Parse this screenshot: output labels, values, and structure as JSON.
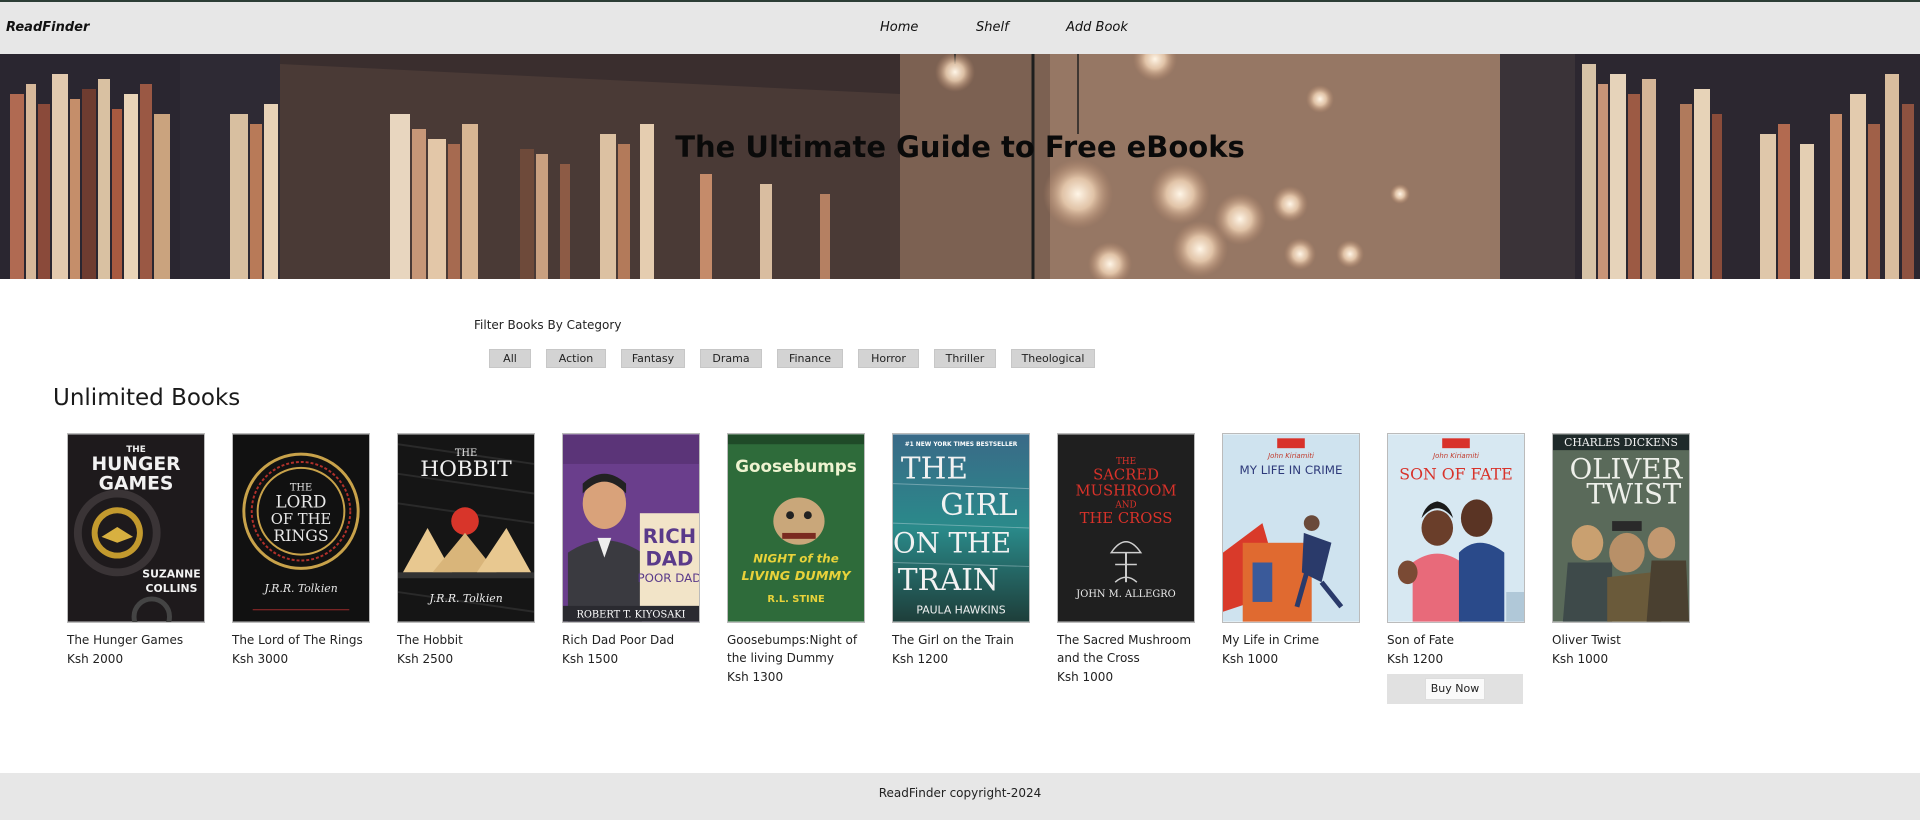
{
  "nav": {
    "brand": "ReadFinder",
    "links": [
      "Home",
      "Shelf",
      "Add Book"
    ]
  },
  "hero": {
    "title": "The Ultimate Guide to Free eBooks"
  },
  "filter": {
    "label": "Filter Books By Category",
    "categories": [
      "All",
      "Action",
      "Fantasy",
      "Drama",
      "Finance",
      "Horror",
      "Thriller",
      "Theological"
    ]
  },
  "books_section": {
    "title": "Unlimited Books",
    "buy_label": "Buy Now",
    "books": [
      {
        "title": "The Hunger Games",
        "price": "Ksh 2000",
        "cover_lines": [
          "THE",
          "HUNGER",
          "GAMES",
          "SUZANNE",
          "COLLINS"
        ]
      },
      {
        "title": "The Lord of The Rings",
        "price": "Ksh 3000",
        "cover_lines": [
          "THE",
          "LORD",
          "OF THE",
          "RINGS",
          "J.R.R. Tolkien"
        ]
      },
      {
        "title": "The Hobbit",
        "price": "Ksh 2500",
        "cover_lines": [
          "THE",
          "HOBBIT",
          "J.R.R. Tolkien"
        ]
      },
      {
        "title": "Rich Dad Poor Dad",
        "price": "Ksh 1500",
        "cover_lines": [
          "RICH",
          "DAD",
          "POOR DAD",
          "ROBERT T. KIYOSAKI"
        ]
      },
      {
        "title": "Goosebumps:Night of the living Dummy",
        "price": "Ksh 1300",
        "cover_lines": [
          "Goosebumps",
          "NIGHT of the",
          "LIVING DUMMY",
          "R.L. STINE"
        ]
      },
      {
        "title": "The Girl on the Train",
        "price": "Ksh 1200",
        "cover_lines": [
          "#1 NEW YORK TIMES BESTSELLER",
          "THE",
          "GIRL",
          "ON THE",
          "TRAIN",
          "PAULA HAWKINS"
        ]
      },
      {
        "title": "The Sacred Mushroom and the Cross",
        "price": "Ksh 1000",
        "cover_lines": [
          "THE",
          "SACRED",
          "MUSHROOM",
          "AND",
          "THE CROSS",
          "JOHN M. ALLEGRO"
        ]
      },
      {
        "title": "My Life in Crime",
        "price": "Ksh 1000",
        "cover_lines": [
          "John Kiriamiti",
          "MY LIFE IN CRIME"
        ]
      },
      {
        "title": "Son of Fate",
        "price": "Ksh 1200",
        "cover_lines": [
          "John Kiriamiti",
          "SON OF FATE"
        ]
      },
      {
        "title": "Oliver Twist",
        "price": "Ksh 1000",
        "cover_lines": [
          "CHARLES DICKENS",
          "OLIVER",
          "TWIST"
        ]
      }
    ]
  },
  "footer": {
    "text": "ReadFinder copyright-2024"
  }
}
